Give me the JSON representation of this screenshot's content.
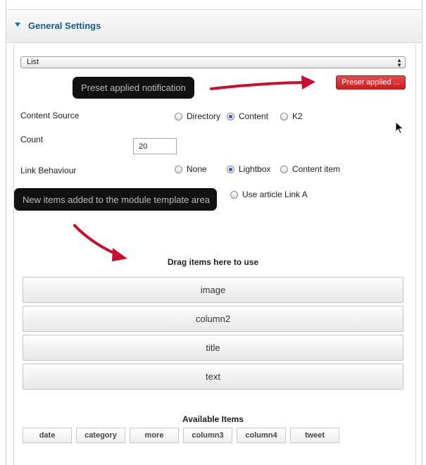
{
  "panel": {
    "title": "General Settings"
  },
  "layout_select": {
    "value": "List"
  },
  "callouts": {
    "preset": "Preset applied notification",
    "new_items": "New items added to the module template area"
  },
  "preset_button": {
    "label": "Preset applied ..."
  },
  "content_source": {
    "label": "Content Source",
    "options": [
      {
        "label": "Directory",
        "checked": false
      },
      {
        "label": "Content",
        "checked": true
      },
      {
        "label": "K2",
        "checked": false
      }
    ]
  },
  "count": {
    "label": "Count",
    "value": "20"
  },
  "link_behaviour": {
    "label": "Link Behaviour",
    "options": [
      {
        "label": "None",
        "checked": false
      },
      {
        "label": "Lightbox",
        "checked": true
      },
      {
        "label": "Content item",
        "checked": false
      }
    ],
    "extra_option": {
      "label": "Use article Link A",
      "checked": false
    }
  },
  "drop_area": {
    "title": "Drag items here to use",
    "items": [
      "image",
      "column2",
      "title",
      "text"
    ]
  },
  "available": {
    "title": "Available Items",
    "items": [
      "date",
      "category",
      "more",
      "column3",
      "column4",
      "tweet"
    ]
  },
  "colors": {
    "accent": "#145b8a",
    "preset_button": "#d42a2a",
    "arrow": "#c8102e",
    "callout_bg": "#111111"
  },
  "icons": [
    "caret-down-icon",
    "select-arrows-icon",
    "radio-icon",
    "annotation-arrow-icon",
    "mouse-cursor-icon"
  ]
}
